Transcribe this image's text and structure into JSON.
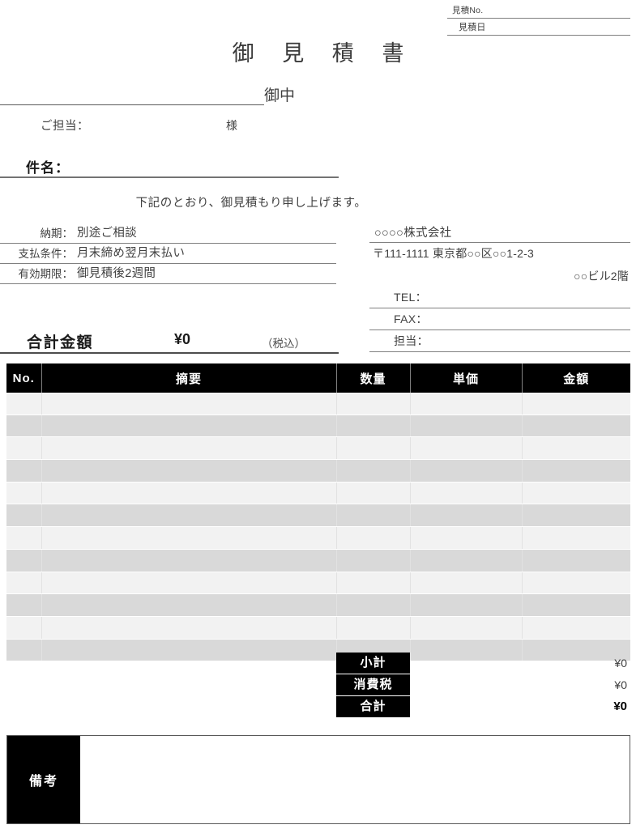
{
  "meta": {
    "quote_no_label": "見積No.",
    "quote_no_value": "",
    "quote_date_label": "見積日",
    "quote_date_value": ""
  },
  "title": "御 見 積 書",
  "recipient": {
    "company_value": "",
    "honorific": "御中",
    "contact_label": "ご担当：",
    "contact_value": "",
    "contact_honorific": "様"
  },
  "subject": {
    "label": "件名：",
    "value": ""
  },
  "intro_text": "下記のとおり、御見積もり申し上げます。",
  "terms": [
    {
      "label": "納期：",
      "value": "別途ご相談"
    },
    {
      "label": "支払条件：",
      "value": "月末締め翌月末払い"
    },
    {
      "label": "有効期限：",
      "value": "御見積後2週間"
    }
  ],
  "company": {
    "name": "○○○○株式会社",
    "address_line1": "〒111-1111 東京都○○区○○1-2-3",
    "address_line2": "○○ビル2階",
    "fields": [
      {
        "label": "TEL：",
        "value": ""
      },
      {
        "label": "FAX：",
        "value": ""
      },
      {
        "label": "担当：",
        "value": ""
      }
    ]
  },
  "grand_total": {
    "label": "合計金額",
    "value": "¥0",
    "note": "（税込）"
  },
  "items_table": {
    "headers": [
      "No.",
      "摘要",
      "数量",
      "単価",
      "金額"
    ],
    "rows": [
      {
        "no": "",
        "desc": "",
        "qty": "",
        "price": "",
        "amount": ""
      },
      {
        "no": "",
        "desc": "",
        "qty": "",
        "price": "",
        "amount": ""
      },
      {
        "no": "",
        "desc": "",
        "qty": "",
        "price": "",
        "amount": ""
      },
      {
        "no": "",
        "desc": "",
        "qty": "",
        "price": "",
        "amount": ""
      },
      {
        "no": "",
        "desc": "",
        "qty": "",
        "price": "",
        "amount": ""
      },
      {
        "no": "",
        "desc": "",
        "qty": "",
        "price": "",
        "amount": ""
      },
      {
        "no": "",
        "desc": "",
        "qty": "",
        "price": "",
        "amount": ""
      },
      {
        "no": "",
        "desc": "",
        "qty": "",
        "price": "",
        "amount": ""
      },
      {
        "no": "",
        "desc": "",
        "qty": "",
        "price": "",
        "amount": ""
      },
      {
        "no": "",
        "desc": "",
        "qty": "",
        "price": "",
        "amount": ""
      },
      {
        "no": "",
        "desc": "",
        "qty": "",
        "price": "",
        "amount": ""
      },
      {
        "no": "",
        "desc": "",
        "qty": "",
        "price": "",
        "amount": ""
      }
    ]
  },
  "totals": [
    {
      "label": "小計",
      "value": "¥0"
    },
    {
      "label": "消費税",
      "value": "¥0"
    },
    {
      "label": "合計",
      "value": "¥0"
    }
  ],
  "remarks": {
    "label": "備考",
    "value": ""
  },
  "colors": {
    "header_bg": "#000000",
    "header_text": "#ffffff",
    "row_light": "#f2f2f2",
    "row_dark": "#d9d9d9",
    "rule": "#808080",
    "text": "#3f3f3f"
  }
}
